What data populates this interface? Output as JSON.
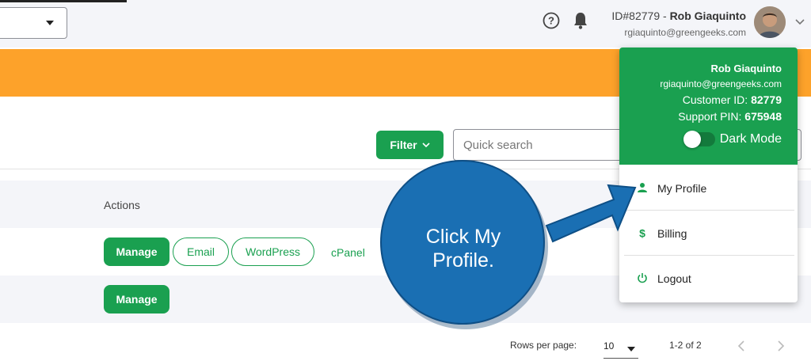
{
  "header": {
    "user_id_text": "ID#82779 - ",
    "user_name": "Rob Giaquinto",
    "user_email": "rgiaquinto@greengeeks.com"
  },
  "toolbar": {
    "filter_label": "Filter",
    "search_placeholder": "Quick search"
  },
  "table": {
    "actions_header": "Actions",
    "rows": [
      {
        "manage": "Manage",
        "email": "Email",
        "wordpress": "WordPress",
        "cpanel": "cPanel"
      },
      {
        "manage": "Manage"
      }
    ]
  },
  "pagination": {
    "rows_per_page_label": "Rows per page:",
    "rows_per_page_value": "10",
    "range": "1-2 of 2"
  },
  "dropdown": {
    "name": "Rob Giaquinto",
    "email": "rgiaquinto@greengeeks.com",
    "customer_id_label": "Customer ID:",
    "customer_id": "82779",
    "support_pin_label": "Support PIN:",
    "support_pin": "675948",
    "dark_mode_label": "Dark Mode",
    "dark_mode_on": false,
    "items": [
      {
        "label": "My Profile",
        "icon": "person-icon"
      },
      {
        "label": "Billing",
        "icon": "dollar-icon"
      },
      {
        "label": "Logout",
        "icon": "power-icon"
      }
    ]
  },
  "callout": {
    "text_line1": "Click My",
    "text_line2": "Profile."
  },
  "colors": {
    "brand_green": "#1aa050",
    "banner_orange": "#fda22a",
    "callout_blue": "#1a6fb3"
  }
}
